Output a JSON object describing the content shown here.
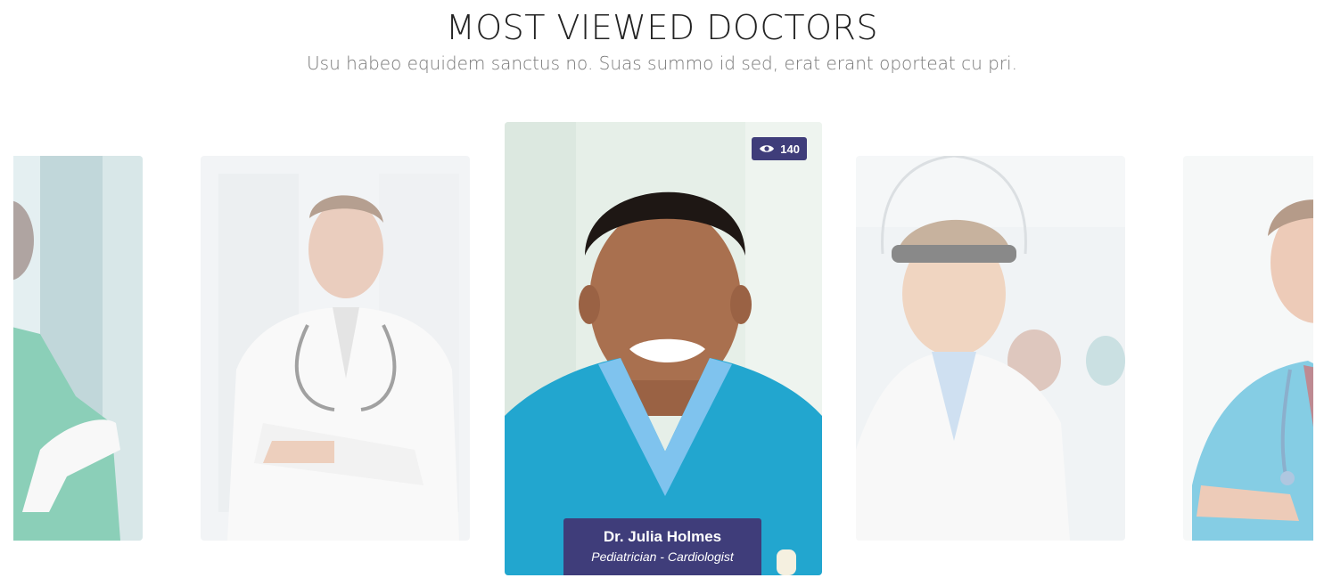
{
  "section": {
    "title": "MOST VIEWED DOCTORS",
    "subtitle": "Usu habeo equidem sanctus no. Suas summo id sed, erat erant oporteat cu pri."
  },
  "carousel": {
    "active_index": 2,
    "active_doctor": {
      "name": "Dr. Julia Holmes",
      "specialty": "Pediatrician - Cardiologist",
      "views": "140",
      "views_icon": "eye-icon"
    }
  },
  "colors": {
    "accent": "#3f3d7a",
    "title_text": "#222222",
    "subtitle_text": "#777777"
  }
}
